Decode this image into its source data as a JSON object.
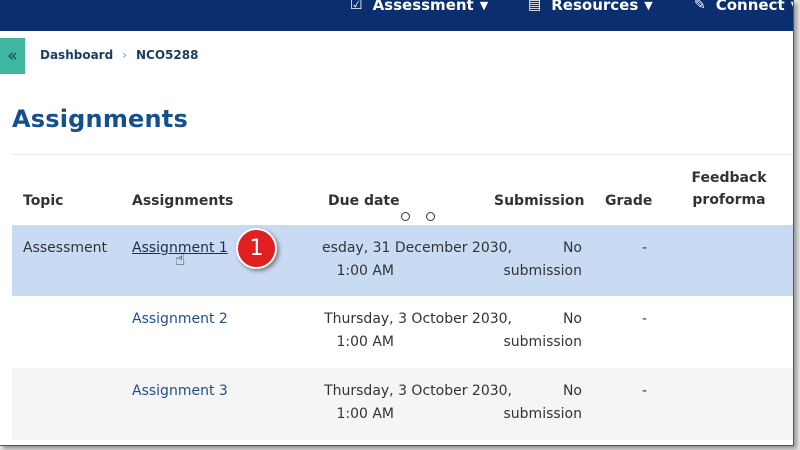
{
  "topnav": {
    "items": [
      {
        "label": "Assessment",
        "icon": "checkbox-icon"
      },
      {
        "label": "Resources",
        "icon": "document-icon"
      },
      {
        "label": "Connect",
        "icon": "pin-icon"
      }
    ],
    "color": "#0a2e6e"
  },
  "breadcrumb": {
    "items": [
      "Dashboard",
      "NCO5288"
    ],
    "separator": "›"
  },
  "page": {
    "title": "Assignments"
  },
  "table": {
    "headers": {
      "topic": "Topic",
      "assignments": "Assignments",
      "due_date": "Due date",
      "submission": "Submission",
      "grade": "Grade",
      "feedback": "Feedback proforma"
    },
    "rows": [
      {
        "topic": "Assessment",
        "assignment": "Assignment 1",
        "due_line1": "esday, 31 December 2030,",
        "due_line2": "1:00 AM",
        "submission": "No submission",
        "grade": "-",
        "highlighted": true
      },
      {
        "topic": "",
        "assignment": "Assignment 2",
        "due_line1": "Thursday, 3 October 2030,",
        "due_line2": "1:00 AM",
        "submission": "No submission",
        "grade": "-",
        "highlighted": false
      },
      {
        "topic": "",
        "assignment": "Assignment 3",
        "due_line1": "Thursday, 3 October 2030,",
        "due_line2": "1:00 AM",
        "submission": "No submission",
        "grade": "-",
        "highlighted": false
      }
    ]
  },
  "annotation": {
    "step": "1",
    "color": "#e02020"
  },
  "colors": {
    "accent": "#13508c",
    "highlight_row": "#c9dbf3",
    "toggle": "#3fb6a0"
  }
}
